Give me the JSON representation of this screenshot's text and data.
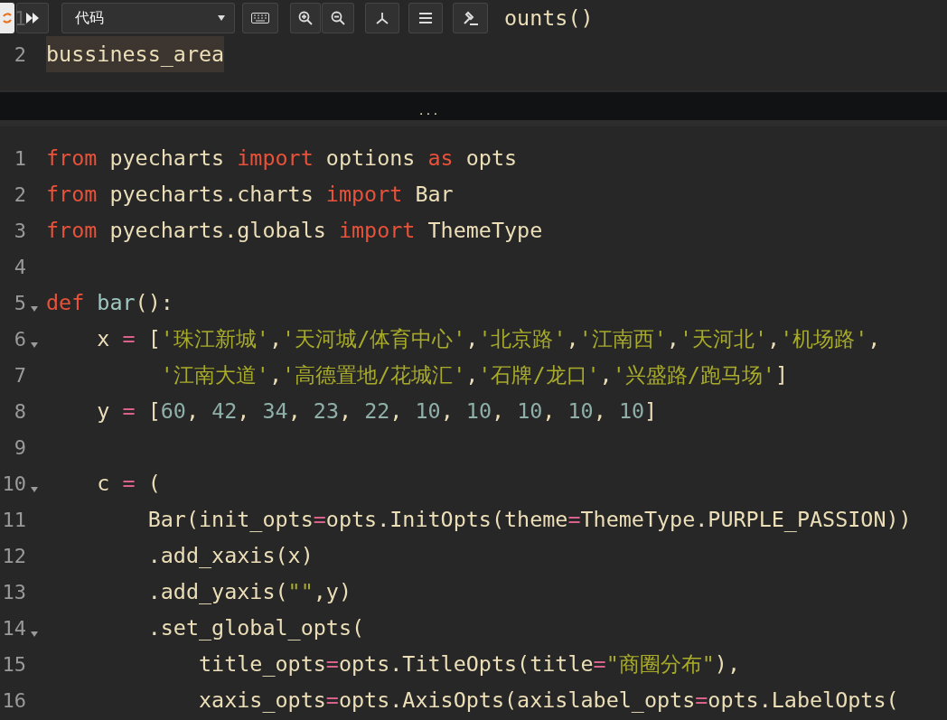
{
  "toolbar": {
    "cell_type": "代码"
  },
  "cells": [
    {
      "lines": [
        {
          "number": "1",
          "foldable": false,
          "tokens": [
            {
              "kind": "plain",
              "text": "                                    ounts()"
            }
          ]
        },
        {
          "number": "2",
          "foldable": false,
          "tokens": [
            {
              "kind": "match",
              "text": "bussiness_area"
            }
          ]
        }
      ]
    },
    {
      "lines": [
        {
          "number": "1",
          "foldable": false,
          "tokens": [
            {
              "kind": "kw",
              "text": "from"
            },
            {
              "kind": "plain",
              "text": " pyecharts "
            },
            {
              "kind": "kw",
              "text": "import"
            },
            {
              "kind": "plain",
              "text": " options "
            },
            {
              "kind": "kw",
              "text": "as"
            },
            {
              "kind": "plain",
              "text": " opts"
            }
          ]
        },
        {
          "number": "2",
          "foldable": false,
          "tokens": [
            {
              "kind": "kw",
              "text": "from"
            },
            {
              "kind": "plain",
              "text": " pyecharts.charts "
            },
            {
              "kind": "kw",
              "text": "import"
            },
            {
              "kind": "plain",
              "text": " Bar"
            }
          ]
        },
        {
          "number": "3",
          "foldable": false,
          "tokens": [
            {
              "kind": "kw",
              "text": "from"
            },
            {
              "kind": "plain",
              "text": " pyecharts.globals "
            },
            {
              "kind": "kw",
              "text": "import"
            },
            {
              "kind": "plain",
              "text": " ThemeType"
            }
          ]
        },
        {
          "number": "4",
          "foldable": false
        },
        {
          "number": "5",
          "foldable": true,
          "tokens": [
            {
              "kind": "kw",
              "text": "def"
            },
            {
              "kind": "def",
              "text": " bar"
            },
            {
              "kind": "plain",
              "text": "():"
            }
          ]
        },
        {
          "number": "6",
          "foldable": true,
          "tokens": [
            {
              "kind": "plain",
              "text": "    x "
            },
            {
              "kind": "op",
              "text": "="
            },
            {
              "kind": "plain",
              "text": " ["
            },
            {
              "kind": "str",
              "text": "'珠江新城'"
            },
            {
              "kind": "plain",
              "text": ","
            },
            {
              "kind": "str",
              "text": "'天河城/体育中心'"
            },
            {
              "kind": "plain",
              "text": ","
            },
            {
              "kind": "str",
              "text": "'北京路'"
            },
            {
              "kind": "plain",
              "text": ","
            },
            {
              "kind": "str",
              "text": "'江南西'"
            },
            {
              "kind": "plain",
              "text": ","
            },
            {
              "kind": "str",
              "text": "'天河北'"
            },
            {
              "kind": "plain",
              "text": ","
            },
            {
              "kind": "str",
              "text": "'机场路'"
            },
            {
              "kind": "plain",
              "text": ","
            }
          ]
        },
        {
          "number": "7",
          "foldable": false,
          "tokens": [
            {
              "kind": "str",
              "text": "         '江南大道'"
            },
            {
              "kind": "plain",
              "text": ","
            },
            {
              "kind": "str",
              "text": "'高德置地/花城汇'"
            },
            {
              "kind": "plain",
              "text": ","
            },
            {
              "kind": "str",
              "text": "'石牌/龙口'"
            },
            {
              "kind": "plain",
              "text": ","
            },
            {
              "kind": "str",
              "text": "'兴盛路/跑马场'"
            },
            {
              "kind": "plain",
              "text": "]"
            }
          ]
        },
        {
          "number": "8",
          "foldable": false,
          "tokens": [
            {
              "kind": "plain",
              "text": "    y "
            },
            {
              "kind": "op",
              "text": "="
            },
            {
              "kind": "plain",
              "text": " ["
            },
            {
              "kind": "num",
              "text": "60"
            },
            {
              "kind": "plain",
              "text": ", "
            },
            {
              "kind": "num",
              "text": "42"
            },
            {
              "kind": "plain",
              "text": ", "
            },
            {
              "kind": "num",
              "text": "34"
            },
            {
              "kind": "plain",
              "text": ", "
            },
            {
              "kind": "num",
              "text": "23"
            },
            {
              "kind": "plain",
              "text": ", "
            },
            {
              "kind": "num",
              "text": "22"
            },
            {
              "kind": "plain",
              "text": ", "
            },
            {
              "kind": "num",
              "text": "10"
            },
            {
              "kind": "plain",
              "text": ", "
            },
            {
              "kind": "num",
              "text": "10"
            },
            {
              "kind": "plain",
              "text": ", "
            },
            {
              "kind": "num",
              "text": "10"
            },
            {
              "kind": "plain",
              "text": ", "
            },
            {
              "kind": "num",
              "text": "10"
            },
            {
              "kind": "plain",
              "text": ", "
            },
            {
              "kind": "num",
              "text": "10"
            },
            {
              "kind": "plain",
              "text": "]"
            }
          ]
        },
        {
          "number": "9",
          "foldable": false
        },
        {
          "number": "10",
          "foldable": true,
          "tokens": [
            {
              "kind": "plain",
              "text": "    c "
            },
            {
              "kind": "op",
              "text": "="
            },
            {
              "kind": "plain",
              "text": " ("
            }
          ]
        },
        {
          "number": "11",
          "foldable": false,
          "tokens": [
            {
              "kind": "plain",
              "text": "        Bar(init_opts"
            },
            {
              "kind": "op",
              "text": "="
            },
            {
              "kind": "plain",
              "text": "opts.InitOpts(theme"
            },
            {
              "kind": "op",
              "text": "="
            },
            {
              "kind": "plain",
              "text": "ThemeType.PURPLE_PASSION))"
            }
          ]
        },
        {
          "number": "12",
          "foldable": false,
          "tokens": [
            {
              "kind": "plain",
              "text": "        .add_xaxis(x)"
            }
          ]
        },
        {
          "number": "13",
          "foldable": false,
          "tokens": [
            {
              "kind": "plain",
              "text": "        .add_yaxis("
            },
            {
              "kind": "str",
              "text": "\"\""
            },
            {
              "kind": "plain",
              "text": ",y)"
            }
          ]
        },
        {
          "number": "14",
          "foldable": true,
          "tokens": [
            {
              "kind": "plain",
              "text": "        .set_global_opts("
            }
          ]
        },
        {
          "number": "15",
          "foldable": false,
          "tokens": [
            {
              "kind": "plain",
              "text": "            title_opts"
            },
            {
              "kind": "op",
              "text": "="
            },
            {
              "kind": "plain",
              "text": "opts.TitleOpts(title"
            },
            {
              "kind": "op",
              "text": "="
            },
            {
              "kind": "str",
              "text": "\"商圈分布\""
            },
            {
              "kind": "plain",
              "text": "),"
            }
          ]
        },
        {
          "number": "16",
          "foldable": false,
          "tokens": [
            {
              "kind": "plain",
              "text": "            xaxis_opts"
            },
            {
              "kind": "op",
              "text": "="
            },
            {
              "kind": "plain",
              "text": "opts.AxisOpts(axislabel_opts"
            },
            {
              "kind": "op",
              "text": "="
            },
            {
              "kind": "plain",
              "text": "opts.LabelOpts("
            }
          ]
        }
      ]
    }
  ],
  "divider": {
    "label": "..."
  }
}
